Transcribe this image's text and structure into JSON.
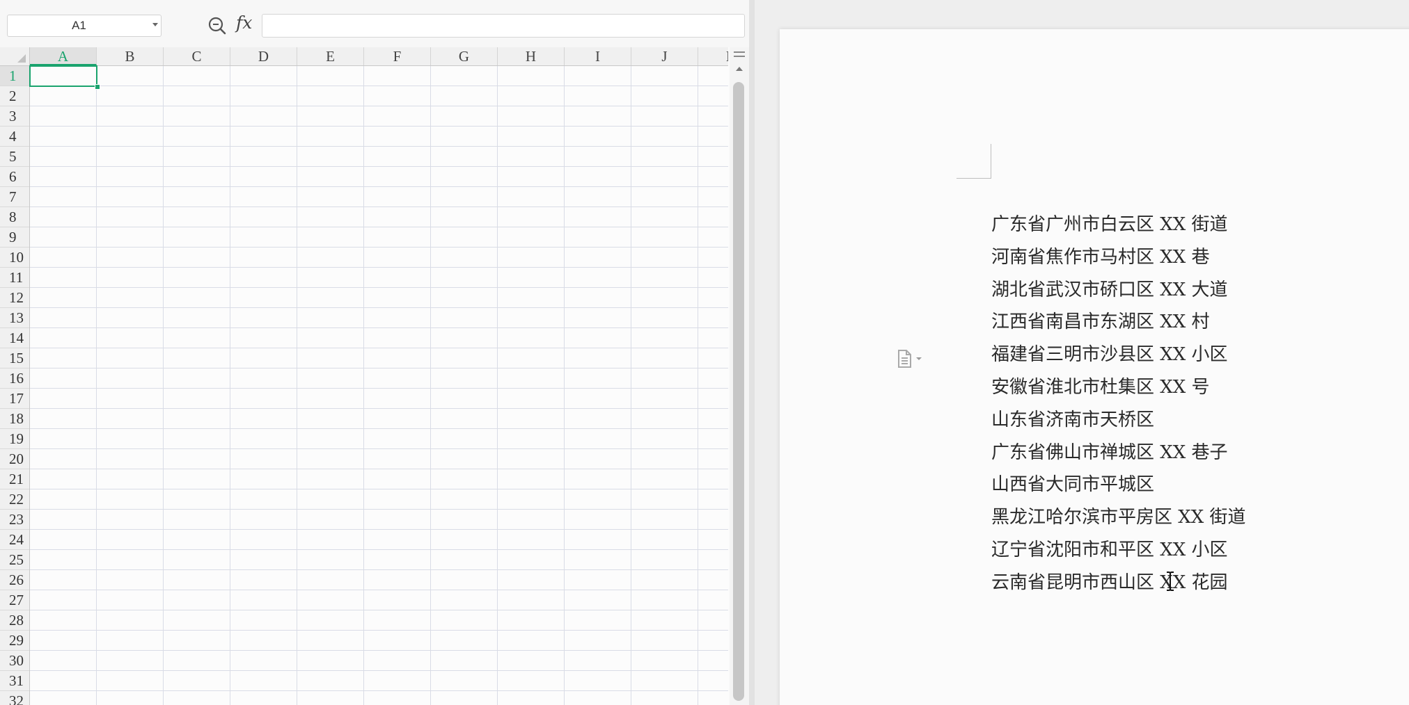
{
  "spreadsheet": {
    "namebox": {
      "value": "A1"
    },
    "formula_bar": {
      "value": "",
      "fx_label": "fx"
    },
    "columns": [
      "A",
      "B",
      "C",
      "D",
      "E",
      "F",
      "G",
      "H",
      "I",
      "J",
      "K"
    ],
    "active_column": "A",
    "rows": [
      "1",
      "2",
      "3",
      "4",
      "5",
      "6",
      "7",
      "8",
      "9",
      "10",
      "11",
      "12",
      "13",
      "14",
      "15",
      "16",
      "17",
      "18",
      "19",
      "20",
      "21",
      "22",
      "23",
      "24",
      "25",
      "26",
      "27",
      "28",
      "29",
      "30",
      "31",
      "32"
    ],
    "active_row": "1",
    "active_cell": "A1",
    "accent_color": "#1aa36d"
  },
  "document": {
    "lines": [
      "广东省广州市白云区 XX 街道",
      "河南省焦作市马村区 XX 巷",
      "湖北省武汉市硚口区 XX 大道",
      "江西省南昌市东湖区 XX 村",
      "福建省三明市沙县区 XX 小区",
      "安徽省淮北市杜集区 XX 号",
      "山东省济南市天桥区",
      "广东省佛山市禅城区 XX 巷子",
      "山西省大同市平城区",
      "黑龙江哈尔滨市平房区 XX 街道",
      "辽宁省沈阳市和平区 XX 小区",
      "云南省昆明市西山区 XX 花园"
    ],
    "paste_options_icon": "paste-options-icon",
    "cursor_icon": "i-beam-cursor-icon"
  }
}
